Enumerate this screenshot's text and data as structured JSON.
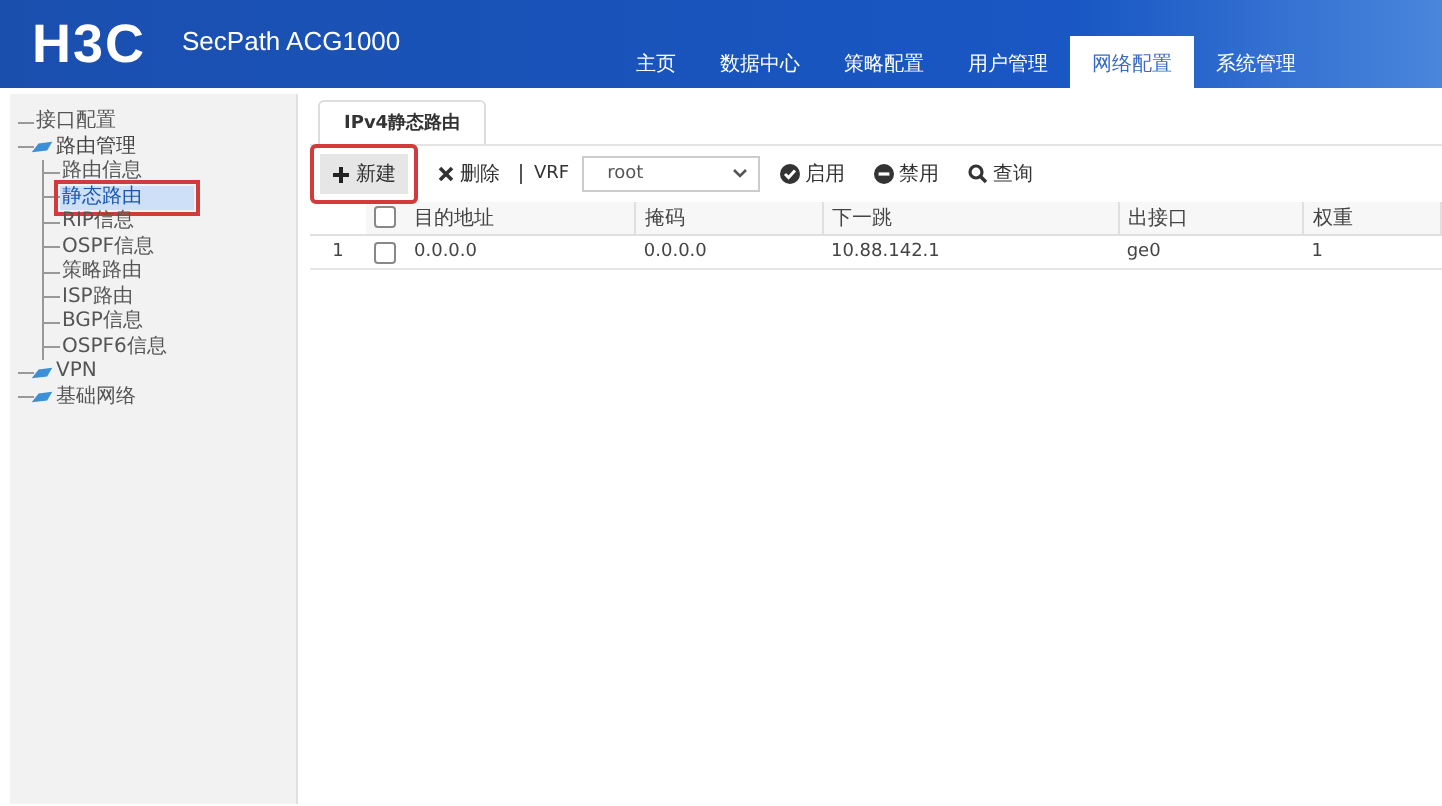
{
  "header": {
    "logo": "H3C",
    "product": "SecPath ACG1000",
    "nav": [
      {
        "label": "主页",
        "selected": false
      },
      {
        "label": "数据中心",
        "selected": false
      },
      {
        "label": "策略配置",
        "selected": false
      },
      {
        "label": "用户管理",
        "selected": false
      },
      {
        "label": "网络配置",
        "selected": true
      },
      {
        "label": "系统管理",
        "selected": false
      }
    ]
  },
  "sidebar": {
    "items": [
      {
        "label": "接口配置",
        "kind": "leaf",
        "selected": false,
        "highlighted": false
      },
      {
        "label": "路由管理",
        "kind": "folder",
        "expanded": true,
        "children": [
          {
            "label": "路由信息",
            "selected": false,
            "highlighted": false
          },
          {
            "label": "静态路由",
            "selected": true,
            "highlighted": true
          },
          {
            "label": "RIP信息",
            "selected": false,
            "highlighted": false
          },
          {
            "label": "OSPF信息",
            "selected": false,
            "highlighted": false
          },
          {
            "label": "策略路由",
            "selected": false,
            "highlighted": false
          },
          {
            "label": "ISP路由",
            "selected": false,
            "highlighted": false
          },
          {
            "label": "BGP信息",
            "selected": false,
            "highlighted": false
          },
          {
            "label": "OSPF6信息",
            "selected": false,
            "highlighted": false
          }
        ]
      },
      {
        "label": "VPN",
        "kind": "folder",
        "expanded": false
      },
      {
        "label": "基础网络",
        "kind": "folder",
        "expanded": false
      }
    ]
  },
  "tabs": [
    {
      "label": "IPv4静态路由",
      "selected": true
    }
  ],
  "toolbar": {
    "new": {
      "label": "新建",
      "highlighted": true
    },
    "delete": "删除",
    "vrf_label": "VRF",
    "vrf_value": "root",
    "enable": "启用",
    "disable": "禁用",
    "query": "查询"
  },
  "table": {
    "all_checked": false,
    "columns": [
      "目的地址",
      "掩码",
      "下一跳",
      "出接口",
      "权重"
    ],
    "rows": [
      {
        "index": "1",
        "checked": false,
        "cells": [
          "0.0.0.0",
          "0.0.0.0",
          "10.88.142.1",
          "ge0",
          "1"
        ]
      }
    ]
  }
}
